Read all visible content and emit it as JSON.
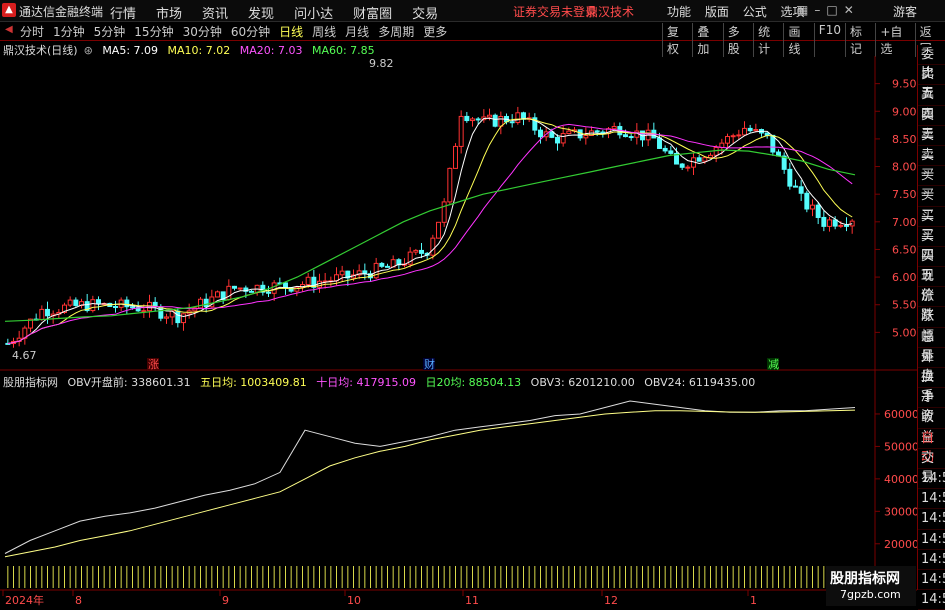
{
  "titlebar": {
    "app_name": "通达信金融终端",
    "menu": [
      "行情",
      "市场",
      "资讯",
      "发现",
      "问小达",
      "财富圈",
      "交易"
    ],
    "warning": "证券交易未登录",
    "stock": "鼎汉技术",
    "right_menu": [
      "功能",
      "版面",
      "公式",
      "选项"
    ],
    "guest": "游客"
  },
  "timeframes": {
    "items": [
      "分时",
      "1分钟",
      "5分钟",
      "15分钟",
      "30分钟",
      "60分钟",
      "日线",
      "周线",
      "月线",
      "多周期",
      "更多"
    ],
    "active": "日线",
    "right_buttons": [
      "复权",
      "叠加",
      "多股",
      "统计",
      "画线",
      "F10",
      "标记",
      "+自选",
      "返回"
    ]
  },
  "main_header": {
    "name": "鼎汉技术(日线)",
    "ma5": "MA5: 7.09",
    "ma10": "MA10: 7.02",
    "ma20": "MA20: 7.03",
    "ma60": "MA60: 7.85"
  },
  "obv_header": {
    "name": "股朋指标网",
    "items": [
      {
        "text": "OBV开盘前: 338601.31",
        "color": "#dddddd"
      },
      {
        "text": "五日均: 1003409.81",
        "color": "#ffff55"
      },
      {
        "text": "十日均: 417915.09",
        "color": "#ff55ff"
      },
      {
        "text": "日20均: 88504.13",
        "color": "#55ff55"
      },
      {
        "text": "OBV3: 6201210.00",
        "color": "#dddddd"
      },
      {
        "text": "OBV24: 6119435.00",
        "color": "#dddddd"
      }
    ]
  },
  "sidebar": [
    "委比",
    "卖五",
    "卖四",
    "卖三",
    "卖二",
    "卖一",
    "买一",
    "买二",
    "买三",
    "买四",
    "买五",
    "现价",
    "涨跌",
    "涨幅",
    "总量",
    "外盘",
    "换手",
    "净资",
    "收益",
    "自动",
    "交易"
  ],
  "sidebar_times": [
    "14:5",
    "14:5",
    "14:5",
    "14:5",
    "14:5",
    "14:5",
    "14:5",
    "14:5"
  ],
  "watermark": {
    "line1": "股朋指标网",
    "line2": "7gpzb.com"
  },
  "markers": {
    "zhang": "涨",
    "cai": "财",
    "jian": "减"
  },
  "colors": {
    "up": "#ff3232",
    "down": "#54fcfc",
    "ma5": "#ffffff",
    "ma10": "#ffff55",
    "ma20": "#ff33ff",
    "ma60": "#33cc33",
    "axis": "#7a0000"
  },
  "chart_data": [
    {
      "type": "candlestick",
      "title": "鼎汉技术(日线)",
      "y_ticks": [
        5.0,
        5.5,
        6.0,
        6.5,
        7.0,
        7.5,
        8.0,
        8.5,
        9.0,
        9.5
      ],
      "ylim": [
        4.5,
        10.0
      ],
      "annotations": {
        "high": "9.82",
        "low": "4.67"
      },
      "x_labels": [
        "2024年",
        "8",
        "9",
        "10",
        "11",
        "12",
        "1"
      ],
      "series": [
        {
          "name": "MA60",
          "values": [
            5.2,
            5.22,
            5.25,
            5.28,
            5.3,
            5.35,
            5.4,
            5.45,
            5.55,
            5.65,
            5.8,
            6.0,
            6.25,
            6.5,
            6.75,
            7.0,
            7.2,
            7.35,
            7.5,
            7.6,
            7.7,
            7.8,
            7.9,
            8.0,
            8.1,
            8.2,
            8.25,
            8.3,
            8.28,
            8.2,
            8.1,
            7.95,
            7.85
          ]
        }
      ]
    },
    {
      "type": "line",
      "title": "OBV",
      "y_ticks": [
        20000,
        30000,
        40000,
        50000,
        60000
      ],
      "ylim": [
        15000,
        68000
      ],
      "series": [
        {
          "name": "OBV",
          "values": [
            17000,
            21000,
            24000,
            27000,
            28500,
            29500,
            31000,
            33000,
            35000,
            36500,
            38500,
            42000,
            55000,
            53000,
            51000,
            50000,
            51500,
            53000,
            55000,
            56000,
            57000,
            58000,
            59500,
            60000,
            62000,
            64000,
            63000,
            62000,
            61000,
            60500,
            60500,
            61000,
            61000,
            61500,
            62000
          ]
        },
        {
          "name": "OBV24",
          "values": [
            16000,
            17500,
            19000,
            21000,
            22500,
            24000,
            26000,
            28000,
            30000,
            32000,
            34000,
            36000,
            40000,
            44000,
            46500,
            48500,
            50000,
            52000,
            53500,
            55000,
            56000,
            57000,
            58000,
            59000,
            60000,
            60500,
            61000,
            61000,
            60800,
            60600,
            60500,
            60600,
            60800,
            61000,
            61200
          ]
        }
      ]
    }
  ]
}
